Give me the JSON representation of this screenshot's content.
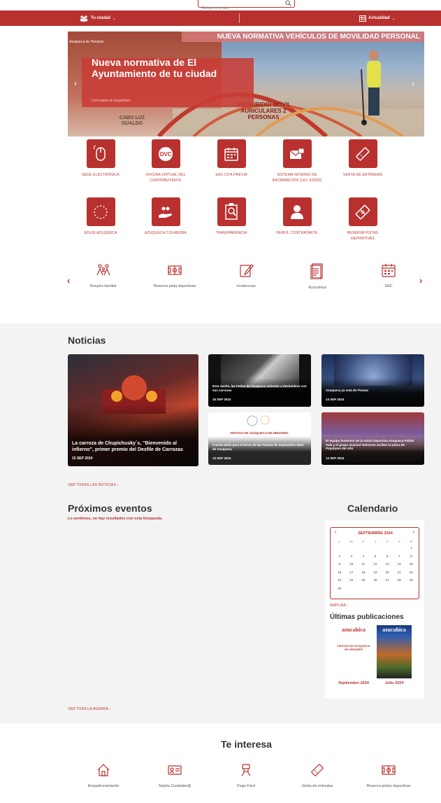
{
  "search": {
    "placeholder": "Buscar en el sitio"
  },
  "nav": {
    "left_label": "Tu ciudad",
    "right_label": "Actualidad"
  },
  "hero": {
    "banner_text": "NUEVA NORMATIVA VEHÍCULOS DE MOVILIDAD PERSONAL",
    "location_label": "Azuqueca de Henares",
    "caption_title": "Nueva normativa de El Ayuntamiento de tu ciudad",
    "caption_source": "Concejalía de Seguridad",
    "sign_text": "¡PROHIBIDO! MÓVIL AURICULARES 2 PERSONAS",
    "street_text": "CABO LUZ GUALDO"
  },
  "services": [
    {
      "label": "Sede electrónica",
      "icon": "mouse-icon"
    },
    {
      "label": "Oficina virtual del contribuyente",
      "icon": "ovc-icon"
    },
    {
      "label": "SAC-Cita previa",
      "icon": "calendar-icon"
    },
    {
      "label": "Sistema interno de información (Ley 2/2023)",
      "icon": "mail-icon"
    },
    {
      "label": "Venta de entradas",
      "icon": "ticket-icon"
    },
    {
      "label": "EDUSI Azuqueca",
      "icon": "eu-stars-icon"
    },
    {
      "label": "Azuqueca colabora",
      "icon": "helping-hand-icon"
    },
    {
      "label": "Transparencia",
      "icon": "magnifier-document-icon"
    },
    {
      "label": "Perfil contratante",
      "icon": "profile-icon"
    },
    {
      "label": "Reserva pistas deportivas",
      "icon": "ticket-court-icon"
    }
  ],
  "quick_links": [
    {
      "label": "Respiro familiar",
      "icon": "family-icon"
    },
    {
      "label": "Reserva pista deportivas",
      "icon": "court-icon"
    },
    {
      "label": "Incidencias",
      "icon": "edit-icon"
    },
    {
      "label": "Azucahica",
      "icon": "magazine-icon"
    },
    {
      "label": "SAC",
      "icon": "calendar-icon"
    }
  ],
  "news_section": {
    "title": "Noticias",
    "items": [
      {
        "title": "La carroza de Chupichusky´s, \"Bienvenido al infierno\", primer premio del Desfile de Carrozas",
        "date": "15 SEP 2024"
      },
      {
        "title": "Esta noche, las Peñas de Azuqueca volverán a deslumbrar con sus carrozas",
        "date": "15 SEP 2024"
      },
      {
        "title": "Azuqueca ya está de Fiestas",
        "date": "14 SEP 2024"
      },
      {
        "title": "Cuenta atrás para el inicio de las Fiestas de Septiembre 2024 de Azuqueca",
        "date": "13 SEP 2024"
      },
      {
        "title": "El equipo femenino de la Unión Deportiva Azuqueca Fútbol Sala y el grupo musical Volovreta reciben la placa de Populares del Año",
        "date": "13 SEP 2024"
      }
    ],
    "poster_text": "FIESTAS DE AZUQUECA DE HENARES",
    "more_label": "Ver todas las noticias"
  },
  "events_section": {
    "title": "Próximos eventos",
    "empty_text": "Lo sentimos, no hay resultados con esta búsqueda.",
    "more_label": "Ver toda la agenda"
  },
  "calendar": {
    "title": "Calendario",
    "month": "SEPTIEMBRE 2024",
    "weekdays": [
      "L",
      "M",
      "X",
      "J",
      "V",
      "S",
      "D"
    ],
    "weeks": [
      [
        "",
        "",
        "",
        "",
        "",
        "",
        "1"
      ],
      [
        "2",
        "3",
        "4",
        "5",
        "6",
        "7",
        "8"
      ],
      [
        "9",
        "10",
        "11",
        "12",
        "13",
        "14",
        "15"
      ],
      [
        "16",
        "17",
        "18",
        "19",
        "20",
        "21",
        "22"
      ],
      [
        "23",
        "24",
        "25",
        "26",
        "27",
        "28",
        "29"
      ],
      [
        "30",
        "",
        "",
        "",
        "",
        "",
        ""
      ]
    ],
    "expand_label": "Ampliar"
  },
  "publications": {
    "title": "Últimas publicaciones",
    "items": [
      {
        "caption": "Septiembre 2024",
        "cover_title": "azucahica",
        "cover_sub": "FIESTAS DE AZUQUECA DE HENARES"
      },
      {
        "caption": "Julio 2024",
        "cover_title": "azucahica"
      }
    ]
  },
  "interest": {
    "title": "Te interesa",
    "items": [
      {
        "label": "Empadronamiento",
        "icon": "house-icon"
      },
      {
        "label": "Tarjeta Ciudadan@",
        "icon": "id-card-icon"
      },
      {
        "label": "Pago Fácil",
        "icon": "payment-icon"
      },
      {
        "label": "Venta de entradas",
        "icon": "ticket-icon"
      },
      {
        "label": "Reserva pistas deportivas",
        "icon": "court-icon"
      }
    ]
  },
  "colors": {
    "brand": "#b8312f",
    "section_bg": "#f3f3f3"
  }
}
